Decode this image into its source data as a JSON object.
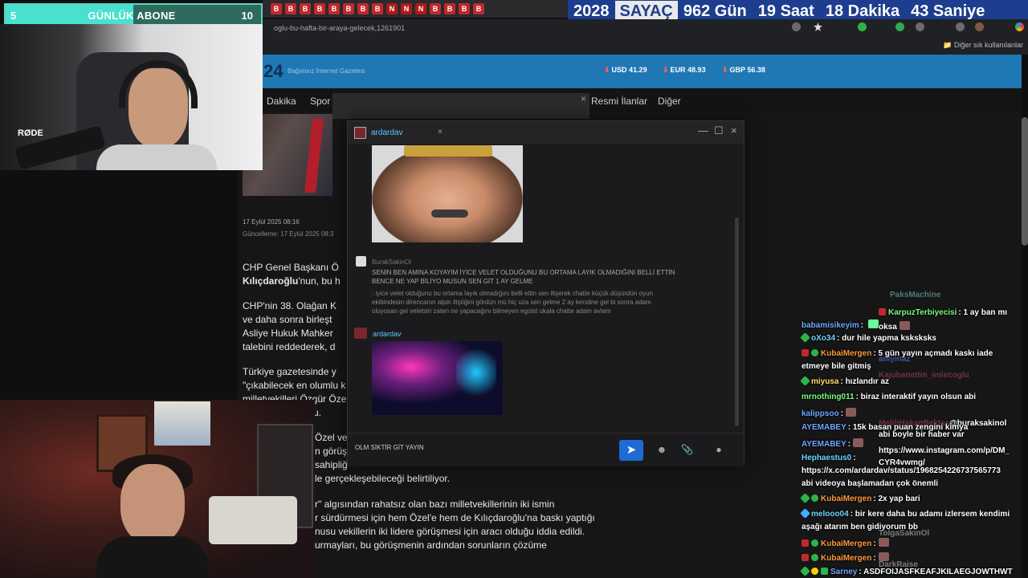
{
  "sub_goal": {
    "current": "5",
    "label": "GÜNLÜK ABONE",
    "goal": "10",
    "progress": 0.5
  },
  "counter": {
    "year": "2028",
    "label": "SAYAÇ",
    "days": "962 Gün",
    "hours": "19 Saat",
    "minutes": "18 Dakika",
    "seconds": "43 Saniye"
  },
  "browser": {
    "url": "oglu-bu-hafta-bir-araya-gelecek,1261901",
    "bookmarks_label": "Diğer sık kullanılanlar",
    "tab_favicons": [
      "B",
      "B",
      "B",
      "B",
      "B",
      "B",
      "B",
      "B",
      "N",
      "N",
      "N",
      "B",
      "B",
      "B",
      "B"
    ]
  },
  "site": {
    "logo": "24",
    "tagline": "Bağımsız İnternet Gazetesi",
    "currencies": [
      "USD 41.29",
      "EUR 48.93",
      "GBP 56.38"
    ],
    "nav": [
      "Dakika",
      "Spor",
      "Resmi İlanlar",
      "Diğer"
    ]
  },
  "article": {
    "date": "17 Eylül 2025 08:16",
    "updated": "Güncelleme: 17 Eylül 2025 08:3",
    "p1_line1": "CHP Genel Başkanı Ö",
    "p1_line2a": "Kılıçdaroğlu",
    "p1_line2b": "'nun, bu h",
    "p2": [
      "CHP'nin 38. Olağan K",
      "ve daha sonra birleşt",
      "Asliye Hukuk Mahker",
      "talebini reddederek, d"
    ],
    "p3": [
      "Türkiye gazetesinde y",
      "\"çıkabilecek en olumlu k",
      "milletvekilleri Özgür Öze",
      "u."
    ],
    "p4": [
      "Özel ve",
      "n görüş",
      "sahipliğ",
      "le gerçekleşebileceği belirtiliyor."
    ],
    "p5": [
      "r\" algısından rahatsız olan bazı milletvekillerinin iki ismin",
      "r sürdürmesi için hem Özel'e hem de Kılıçdaroğlu'na baskı yaptığı",
      "nusu vekillerin iki lidere görüşmesi için aracı olduğu iddia edildi.",
      "urmayları, bu görüşmenin ardından sorunların çözüme"
    ]
  },
  "chat_window": {
    "title": "ardardav",
    "msg1_user": "BurakSakinOl",
    "msg1_line1": "SENİN BEN AMINA KOYAYIM İYİCE VELET OLDUĞUNU BU ORTAMA LAYIK OLMADIĞINI BELLİ ETTİN",
    "msg1_line2": "BENCE NE YAP BİLİYO MUSUN SEN GİT 1 AY GELME",
    "msg1_quote1": ": iyice velet olduğunu bu ortama layık olmadığını belli ettin sen iltşerek chatte küçük düşürdün oyun",
    "msg1_quote2": "ekibindesin direncanın alpin iltştiğini gördün mü hiç uza sen gelme 2 ay kendine gel bi sonra adam",
    "msg1_quote3": "oluyosan gel veletsin zaten ne yapacağını bilmeyen egoist ukala chatte adam avlam",
    "msg2_user": "ardardav",
    "input_text": "OLM SİKTİR GİT YAYIN"
  },
  "cam": {
    "mic_brand": "RØDE"
  },
  "twitch_chat": [
    {
      "user": "KarpuzTerbiyecisi",
      "text": ": 1 ay ban mı",
      "color": "#7CFC7C"
    },
    {
      "user": "babamisikeyim",
      "text": ": ",
      "color": "#6FA8FF",
      "cont": "oksa"
    },
    {
      "user": "oXo34",
      "text": ": dur hile yapma ksksksks",
      "color": "#6FD6FF"
    },
    {
      "user": "KubaiMergen",
      "text": ": 5 gün yayın açmadı kaskı iade",
      "color": "#FF9A3C",
      "cont": "etmeye bile gitmiş"
    },
    {
      "user": "miyusa",
      "text": ": hızlandır az",
      "color": "#FFE066"
    },
    {
      "user": "mrnothing011",
      "text": ": biraz interaktif yayın olsun abi",
      "color": "#7CFC7C"
    },
    {
      "user": "kalippsoo",
      "text": ":",
      "color": "#6FA8FF"
    },
    {
      "user": "AYEMABEY",
      "text": ": 15k basan puan zengini kimya",
      "color": "#6FA8FF"
    },
    {
      "user": "AYEMABEY",
      "text": ":",
      "color": "#6FA8FF"
    },
    {
      "user": "Hephaestus0",
      "text": ":",
      "color": "#6FD6FF"
    },
    {
      "user": "",
      "text": "https://x.com/ardardav/status/1968254226737565773",
      "color": "#fff"
    },
    {
      "user": "",
      "text": "abi videoya başlamadan çok önemli",
      "color": "#fff"
    },
    {
      "user": "KubaiMergen",
      "text": ": 2x yap bari",
      "color": "#FF9A3C"
    },
    {
      "user": "melooo04",
      "text": ": bir kere daha bu adamı izlersem kendimi",
      "color": "#6FD6FF",
      "cont": "aşağı atarım ben gidiyorum bb"
    },
    {
      "user": "KubaiMergen",
      "text": ":",
      "color": "#FF9A3C"
    },
    {
      "user": "KubaiMergen",
      "text": ":",
      "color": "#FF9A3C"
    },
    {
      "user": "Sarney",
      "text": ": ASDFOIJASFKEAFJKILAEGJOWTHWT",
      "color": "#6FA8FF"
    }
  ],
  "twitch_chat_extra": {
    "burak_user": "@buraksakinol",
    "burak_line1": "abi boyle bir haber var",
    "burak_line2": "https://www.instagram.com/p/DM_",
    "burak_line3": "CYR4vwmg/"
  },
  "ghost_names": [
    "PaksMachine",
    "Kajuhanettin_imlecoglu",
    "MelihHakanBektas",
    "TolgaSakinOl",
    "DarkRaise"
  ]
}
